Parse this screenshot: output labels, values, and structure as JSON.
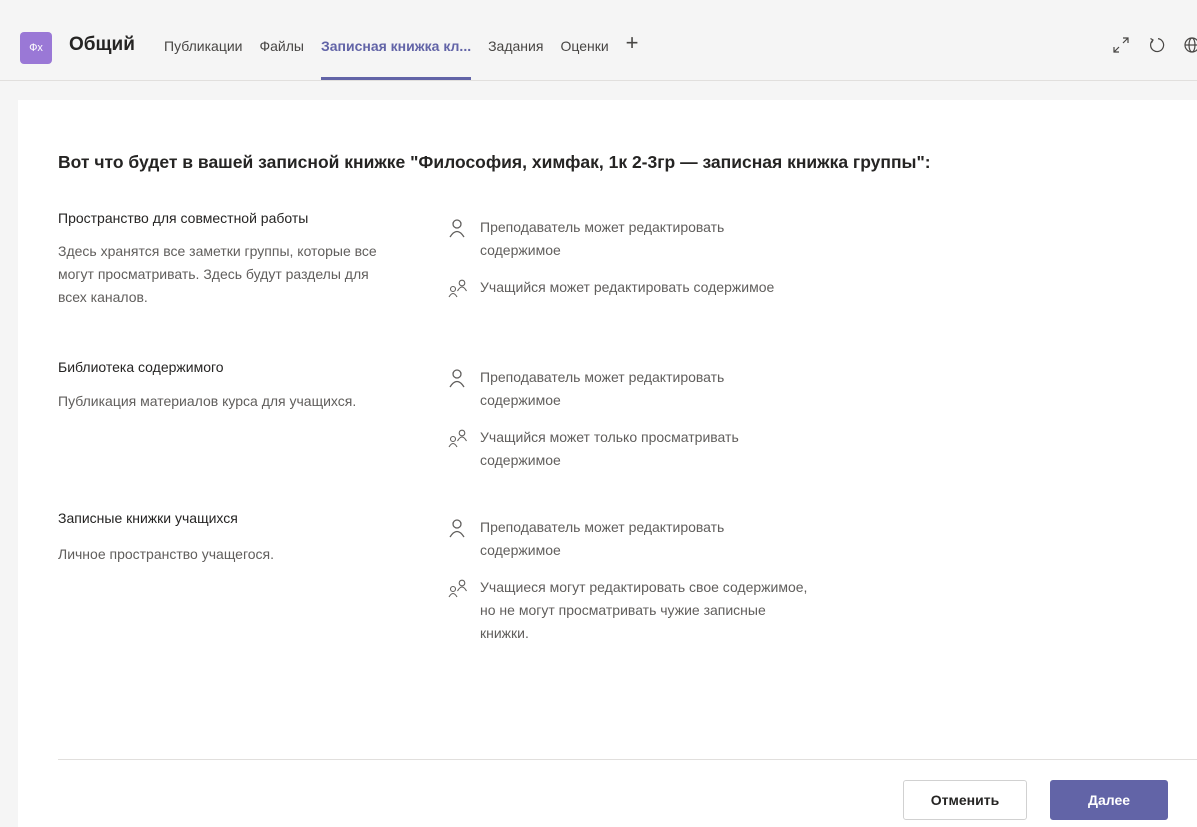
{
  "header": {
    "team_avatar": "Фх",
    "channel_title": "Общий",
    "tabs": [
      {
        "label": "Публикации"
      },
      {
        "label": "Файлы"
      },
      {
        "label": "Записная книжка кл..."
      },
      {
        "label": "Задания"
      },
      {
        "label": "Оценки"
      }
    ],
    "active_tab_index": 2,
    "add_tab_icon": "plus-icon",
    "icons": [
      "expand-icon",
      "refresh-icon",
      "globe-icon"
    ]
  },
  "content": {
    "heading": "Вот что будет в вашей записной книжке \"Философия, химфак, 1к 2-3гр — записная книжка группы\":",
    "sections": [
      {
        "title": "Пространство для совместной работы",
        "description": "Здесь хранятся все заметки группы, которые все могут просматривать. Здесь будут разделы для всех каналов.",
        "permissions": [
          {
            "icon": "person-icon",
            "text": "Преподаватель может редактировать содержимое"
          },
          {
            "icon": "people-icon",
            "text": "Учащийся может редактировать содержимое"
          }
        ]
      },
      {
        "title": "Библиотека содержимого",
        "description": "Публикация материалов курса для учащихся.",
        "permissions": [
          {
            "icon": "person-icon",
            "text": "Преподаватель может редактировать содержимое"
          },
          {
            "icon": "people-icon",
            "text": "Учащийся может только просматривать содержимое"
          }
        ]
      },
      {
        "title": "Записные книжки учащихся",
        "description": "Личное пространство учащегося.",
        "permissions": [
          {
            "icon": "person-icon",
            "text": "Преподаватель может редактировать содержимое"
          },
          {
            "icon": "people-icon",
            "text": "Учащиеся могут редактировать свое содержимое, но не могут просматривать чужие записные книжки."
          }
        ]
      }
    ]
  },
  "footer": {
    "cancel_label": "Отменить",
    "next_label": "Далее"
  },
  "colors": {
    "accent": "#6264a7",
    "avatar": "#9a78d6",
    "muted_text": "#605e5c"
  }
}
